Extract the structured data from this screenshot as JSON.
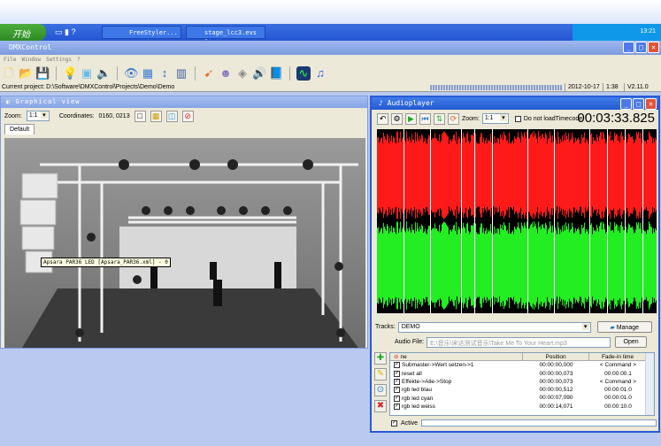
{
  "taskbar": {
    "start": "开始",
    "tasks": [
      "FreeStyler...",
      "stage_lcc3.evs -..."
    ],
    "clock": "13:21"
  },
  "app": {
    "title": "DMXControl",
    "menu": [
      "File",
      "Window",
      "Settings",
      "?"
    ],
    "status": {
      "project": "Current project: D:\\Software\\DMXControl\\Projects\\Demo\\Demo",
      "date": "2012-10-17",
      "time": "1:38",
      "version": "V2.11.0"
    }
  },
  "graphical": {
    "title": "Graphical view",
    "zoom_label": "Zoom:",
    "zoom": "1:1",
    "coords_label": "Coordinates:",
    "coords": "0160, 0213",
    "tab": "Default",
    "tooltip": "Apsara PAR36 LED [Apsara_PAR36.xml] - 0"
  },
  "audio": {
    "title": "Audioplayer",
    "zoom_label": "Zoom:",
    "zoom": "1:1",
    "no_timecode": "Do not loadTimecode",
    "timecode": "00:03:33.825",
    "tracks_label": "Tracks:",
    "track": "DEMO",
    "manage": "Manage",
    "file_label": "Audio File:",
    "file": "E:\\音乐\\宋达测试音乐\\Take Me To Your Heart.mp3",
    "open": "Open",
    "columns": [
      "ne",
      "Position",
      "Fade-in time"
    ],
    "rows": [
      {
        "name": "Submaster->Wert setzen->1",
        "pos": "00:00:00,000",
        "fade": "< Command >"
      },
      {
        "name": "reset all",
        "pos": "00:00:00,073",
        "fade": "00:00:00.1"
      },
      {
        "name": "Effekte->Alle->Stop",
        "pos": "00:00:00,073",
        "fade": "< Command >"
      },
      {
        "name": "rgb led blau",
        "pos": "00:00:00,512",
        "fade": "00:00:01.0"
      },
      {
        "name": "rgb led cyan",
        "pos": "00:00:07,090",
        "fade": "00:00:01.0"
      },
      {
        "name": "rgb led weiss",
        "pos": "00:00:14,071",
        "fade": "00:00:10.0"
      }
    ],
    "active": "Active"
  }
}
